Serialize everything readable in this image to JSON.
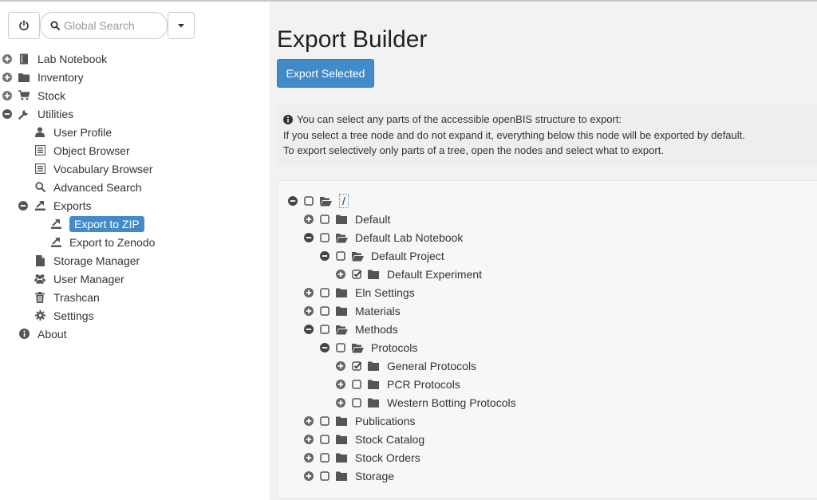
{
  "search": {
    "placeholder": "Global Search"
  },
  "sidebar": {
    "items": [
      {
        "label": "Lab Notebook"
      },
      {
        "label": "Inventory"
      },
      {
        "label": "Stock"
      },
      {
        "label": "Utilities"
      },
      {
        "label": "User Profile"
      },
      {
        "label": "Object Browser"
      },
      {
        "label": "Vocabulary Browser"
      },
      {
        "label": "Advanced Search"
      },
      {
        "label": "Exports"
      },
      {
        "label": "Export to ZIP"
      },
      {
        "label": "Export to Zenodo"
      },
      {
        "label": "Storage Manager"
      },
      {
        "label": "User Manager"
      },
      {
        "label": "Trashcan"
      },
      {
        "label": "Settings"
      },
      {
        "label": "About"
      }
    ]
  },
  "main": {
    "title": "Export Builder",
    "export_button": "Export Selected",
    "info": {
      "line1": "You can select any parts of the accessible openBIS structure to export:",
      "line2": "If you select a tree node and do not expand it, everything below this node will be exported by default.",
      "line3": "To export selectively only parts of a tree, open the nodes and select what to export."
    }
  },
  "tree": {
    "root": "/",
    "nodes": [
      {
        "label": "Default"
      },
      {
        "label": "Default Lab Notebook"
      },
      {
        "label": "Default Project"
      },
      {
        "label": "Default Experiment",
        "checked": true
      },
      {
        "label": "Eln Settings"
      },
      {
        "label": "Materials"
      },
      {
        "label": "Methods"
      },
      {
        "label": "Protocols"
      },
      {
        "label": "General Protocols",
        "checked": true
      },
      {
        "label": "PCR Protocols"
      },
      {
        "label": "Western Botting Protocols"
      },
      {
        "label": "Publications"
      },
      {
        "label": "Stock Catalog"
      },
      {
        "label": "Stock Orders"
      },
      {
        "label": "Storage"
      }
    ]
  },
  "colors": {
    "accent": "#428bca",
    "icon": "#555555",
    "toggle": "#666666"
  }
}
